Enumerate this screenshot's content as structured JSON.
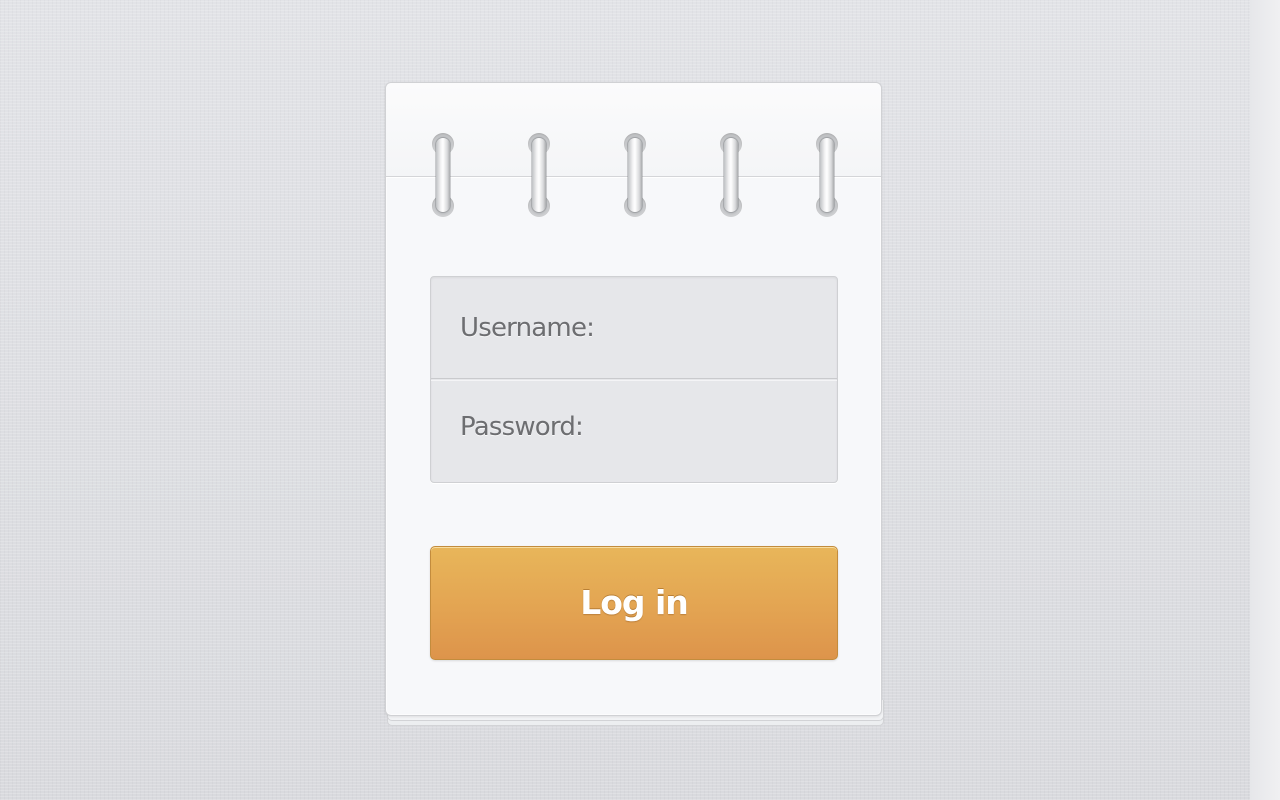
{
  "login_form": {
    "username": {
      "label": "Username:",
      "value": ""
    },
    "password": {
      "label": "Password:",
      "value": ""
    },
    "submit_label": "Log in"
  },
  "notepad": {
    "ring_count": 5
  },
  "colors": {
    "background": "#dcdde1",
    "notepad": "#f7f8fa",
    "field_background": "#e6e7ea",
    "button_top": "#e8b65a",
    "button_bottom": "#dd944b",
    "label_text": "#6d6e71",
    "button_text": "#ffffff"
  },
  "icons": {
    "ring": "spiral-ring-icon"
  }
}
